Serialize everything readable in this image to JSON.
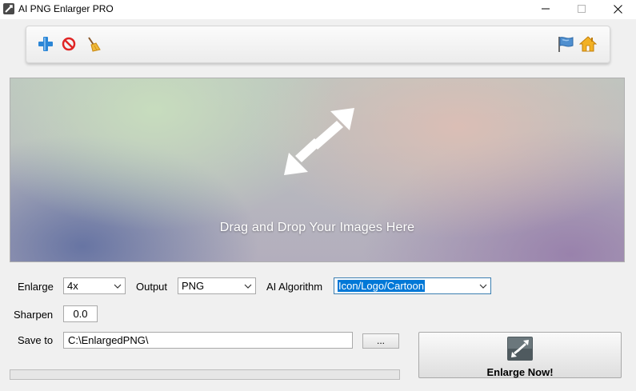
{
  "window": {
    "title": "AI PNG Enlarger PRO"
  },
  "toolbar": {
    "left_icons": [
      "plus-icon",
      "no-entry-icon",
      "broom-icon"
    ],
    "right_icons": [
      "flag-icon",
      "home-icon"
    ]
  },
  "drop_area": {
    "text": "Drag and Drop Your Images Here"
  },
  "form": {
    "enlarge_label": "Enlarge",
    "enlarge_value": "4x",
    "output_label": "Output",
    "output_value": "PNG",
    "algorithm_label": "AI Algorithm",
    "algorithm_value": "Icon/Logo/Cartoon",
    "sharpen_label": "Sharpen",
    "sharpen_value": "0.0",
    "save_label": "Save to",
    "save_value": "C:\\EnlargedPNG\\",
    "browse_label": "..."
  },
  "progress": {
    "percent": 0
  },
  "action": {
    "enlarge_label": "Enlarge Now!"
  },
  "colors": {
    "accent": "#0078d7",
    "plus": "#2b86d6",
    "no_entry": "#e02424",
    "home": "#e8a31a"
  }
}
